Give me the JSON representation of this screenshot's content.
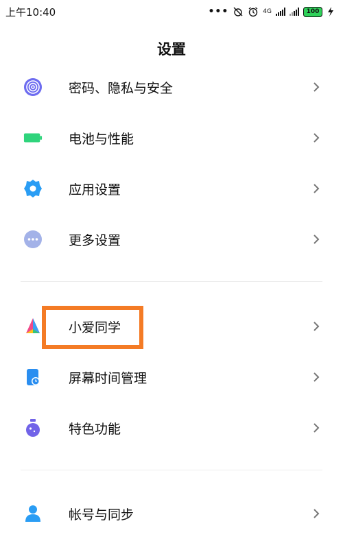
{
  "status_bar": {
    "time": "上午10:40",
    "network": "4G",
    "battery": "100",
    "icons": [
      "more-dots-icon",
      "alarm-off-icon",
      "alarm-icon",
      "signal-icon",
      "signal-icon",
      "battery-icon",
      "charging-icon"
    ]
  },
  "page": {
    "title": "设置"
  },
  "group1": [
    {
      "label": "密码、隐私与安全",
      "icon": "fingerprint-icon",
      "color": "#6d6cf0"
    },
    {
      "label": "电池与性能",
      "icon": "battery-icon",
      "color": "#2fd47c"
    },
    {
      "label": "应用设置",
      "icon": "gear-icon",
      "color": "#2a9df4"
    },
    {
      "label": "更多设置",
      "icon": "more-icon",
      "color": "#a3b2e8"
    }
  ],
  "group2": [
    {
      "label": "小爱同学",
      "icon": "xiaoai-icon"
    },
    {
      "label": "屏幕时间管理",
      "icon": "screen-time-icon",
      "color": "#2a8ef0"
    },
    {
      "label": "特色功能",
      "icon": "flask-icon",
      "color": "#7163e8"
    }
  ],
  "group3": [
    {
      "label": "帐号与同步",
      "icon": "account-icon",
      "color": "#2a9df4"
    }
  ],
  "highlight_color": "#f47b25"
}
